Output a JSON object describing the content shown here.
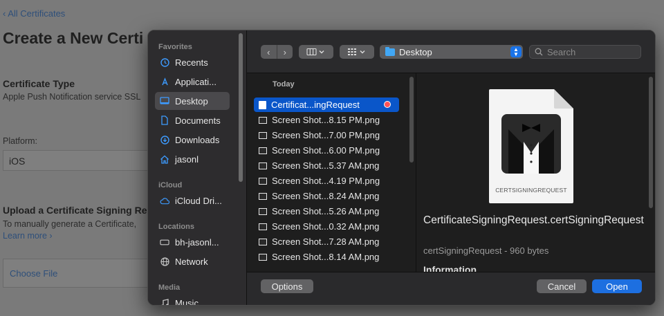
{
  "background": {
    "back_link": "‹ All Certificates",
    "title": "Create a New Certi",
    "cert_type_heading": "Certificate Type",
    "cert_type_value": "Apple Push Notification service SSL",
    "platform_label": "Platform:",
    "platform_value": "iOS",
    "upload_heading": "Upload a Certificate Signing Re",
    "upload_text": "To manually generate a Certificate,",
    "learn_more": "Learn more ›",
    "choose_file": "Choose File"
  },
  "sidebar": {
    "sections": [
      {
        "header": "Favorites"
      },
      {
        "header": "iCloud"
      },
      {
        "header": "Locations"
      },
      {
        "header": "Media"
      }
    ],
    "items": [
      {
        "label": "Recents",
        "icon": "clock-icon"
      },
      {
        "label": "Applicati...",
        "icon": "applications-icon"
      },
      {
        "label": "Desktop",
        "icon": "desktop-icon"
      },
      {
        "label": "Documents",
        "icon": "document-icon"
      },
      {
        "label": "Downloads",
        "icon": "download-icon"
      },
      {
        "label": "jasonl",
        "icon": "home-icon"
      },
      {
        "label": "iCloud Dri...",
        "icon": "cloud-icon"
      },
      {
        "label": "bh-jasonl...",
        "icon": "computer-icon"
      },
      {
        "label": "Network",
        "icon": "globe-icon"
      },
      {
        "label": "Music",
        "icon": "music-icon"
      }
    ],
    "selected": "Desktop"
  },
  "toolbar": {
    "back": "‹",
    "forward": "›",
    "location": "Desktop",
    "search_placeholder": "Search"
  },
  "file_list": {
    "group_header": "Today",
    "files": [
      {
        "name": "Certificat...ingRequest",
        "selected": true
      },
      {
        "name": "Screen Shot...8.15 PM.png"
      },
      {
        "name": "Screen Shot...7.00 PM.png"
      },
      {
        "name": "Screen Shot...6.00 PM.png"
      },
      {
        "name": "Screen Shot...5.37 AM.png"
      },
      {
        "name": "Screen Shot...4.19 PM.png"
      },
      {
        "name": "Screen Shot...8.24 AM.png"
      },
      {
        "name": "Screen Shot...5.26 AM.png"
      },
      {
        "name": "Screen Shot...0.32 AM.png"
      },
      {
        "name": "Screen Shot...7.28 AM.png"
      },
      {
        "name": "Screen Shot...8.14 AM.png"
      }
    ]
  },
  "preview": {
    "icon_caption": "CERTSIGNINGREQUEST",
    "file_name": "CertificateSigningRequest.certSigningRequest",
    "meta": "certSigningRequest - 960 bytes",
    "info_header": "Information"
  },
  "footer": {
    "options": "Options",
    "cancel": "Cancel",
    "open": "Open"
  },
  "colors": {
    "accent": "#1d6fe0",
    "tag_red": "#ff5257",
    "folder_blue": "#41a7f5"
  }
}
